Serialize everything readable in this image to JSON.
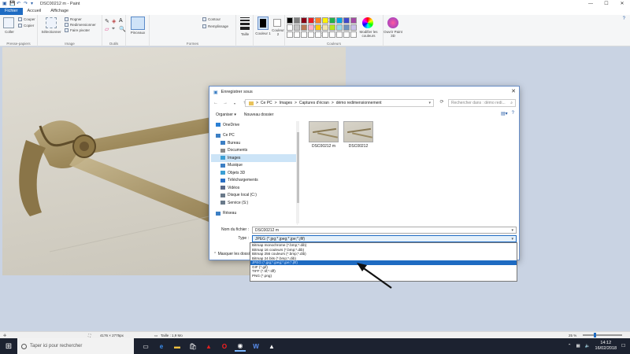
{
  "window": {
    "title": "DSC00212 m - Paint",
    "controls": {
      "minimize": "—",
      "maximize": "☐",
      "close": "✕"
    }
  },
  "ribbon_tabs": [
    "Fichier",
    "Accueil",
    "Affichage"
  ],
  "ribbon": {
    "clipboard": {
      "paste": "Coller",
      "cut": "Couper",
      "copy": "Copier",
      "group": "Presse-papiers"
    },
    "image": {
      "select": "Sélectionner",
      "crop": "Rogner",
      "resize": "Redimensionner",
      "rotate": "Faire pivoter",
      "group": "Image"
    },
    "tools": {
      "group": "Outils"
    },
    "brushes": {
      "label": "Pinceaux"
    },
    "shapes": {
      "outline": "Contour",
      "fill": "Remplissage",
      "group": "Formes"
    },
    "size": {
      "label": "Taille"
    },
    "color1": {
      "label": "Couleur 1"
    },
    "color2": {
      "label": "Couleur 2"
    },
    "colors": {
      "edit": "Modifier les couleurs",
      "group": "Couleurs"
    },
    "paint3d": {
      "label": "Ouvrir Paint 3D"
    },
    "palette": [
      "#000000",
      "#7f7f7f",
      "#880015",
      "#ed1c24",
      "#ff7f27",
      "#fff200",
      "#22b14c",
      "#00a2e8",
      "#3f48cc",
      "#a349a4",
      "#ffffff",
      "#c3c3c3",
      "#b97a57",
      "#ffaec9",
      "#ffc90e",
      "#efe4b0",
      "#b5e61d",
      "#99d9ea",
      "#7092be",
      "#c8bfe7",
      "#ffffff",
      "#ffffff",
      "#ffffff",
      "#ffffff",
      "#ffffff",
      "#ffffff",
      "#ffffff",
      "#ffffff",
      "#ffffff",
      "#ffffff"
    ],
    "shape_glyphs": [
      "╲",
      "◯",
      "▭",
      "▢",
      "△",
      "▷",
      "◇",
      "⬠",
      "⬡",
      "→",
      "←",
      "↑",
      "↓",
      "✦",
      "✧",
      "✩",
      "💬",
      "◌",
      "♡",
      "ϟ",
      "▱"
    ]
  },
  "dialog": {
    "title": "Enregistrer sous",
    "close": "✕",
    "nav": {
      "back": "←",
      "forward": "→",
      "up": "↑"
    },
    "address": [
      "Ce PC",
      "Images",
      "Captures d'écran",
      "démo redimensionnement"
    ],
    "address_sep": ">",
    "refresh": "⟳",
    "search_placeholder": "Rechercher dans : démo redi...",
    "organize": "Organiser ▾",
    "new_folder": "Nouveau dossier",
    "sidebar": [
      {
        "label": "OneDrive",
        "indent": false,
        "selected": false,
        "color": "#2a7fd4"
      },
      {
        "label": "Ce PC",
        "indent": false,
        "selected": false,
        "color": "#3c7fc4"
      },
      {
        "label": "Bureau",
        "indent": true,
        "selected": false,
        "color": "#3c7fc4"
      },
      {
        "label": "Documents",
        "indent": true,
        "selected": false,
        "color": "#8a8a8a"
      },
      {
        "label": "Images",
        "indent": true,
        "selected": true,
        "color": "#3c9fd4"
      },
      {
        "label": "Musique",
        "indent": true,
        "selected": false,
        "color": "#3c7fc4"
      },
      {
        "label": "Objets 3D",
        "indent": true,
        "selected": false,
        "color": "#3c9fd4"
      },
      {
        "label": "Téléchargements",
        "indent": true,
        "selected": false,
        "color": "#2a6fc4"
      },
      {
        "label": "Vidéos",
        "indent": true,
        "selected": false,
        "color": "#5a6a8a"
      },
      {
        "label": "Disque local (C:)",
        "indent": true,
        "selected": false,
        "color": "#6a7a8a"
      },
      {
        "label": "Service (S:)",
        "indent": true,
        "selected": false,
        "color": "#6a7a8a"
      },
      {
        "label": "Réseau",
        "indent": false,
        "selected": false,
        "color": "#3c7fc4"
      }
    ],
    "files": [
      "DSC00212 m",
      "DSC00212"
    ],
    "filename_label": "Nom du fichier :",
    "filename_value": "DSC00212 m",
    "type_label": "Type :",
    "type_value": "JPEG (*.jpg;*.jpeg;*.jpe;*.jfif)",
    "hide_folders": "Masquer les dossiers",
    "type_options": [
      "Bitmap monochrome (*.bmp;*.dib)",
      "Bitmap 16 couleurs (*.bmp;*.dib)",
      "Bitmap 256 couleurs (*.bmp;*.dib)",
      "Bitmap 24 bits (*.bmp;*.dib)",
      "JPEG (*.jpg;*.jpeg;*.jpe;*.jfif)",
      "GIF (*.gif)",
      "TIFF (*.tif;*.tiff)",
      "PNG (*.png)"
    ],
    "type_selected_index": 4
  },
  "statusbar": {
    "dimensions": "4176 × 2775px",
    "filesize": "Taille : 1,9 Mo",
    "zoom": "25 %"
  },
  "taskbar": {
    "search_placeholder": "Taper ici pour rechercher",
    "time": "14:12",
    "date": "16/02/2018"
  }
}
